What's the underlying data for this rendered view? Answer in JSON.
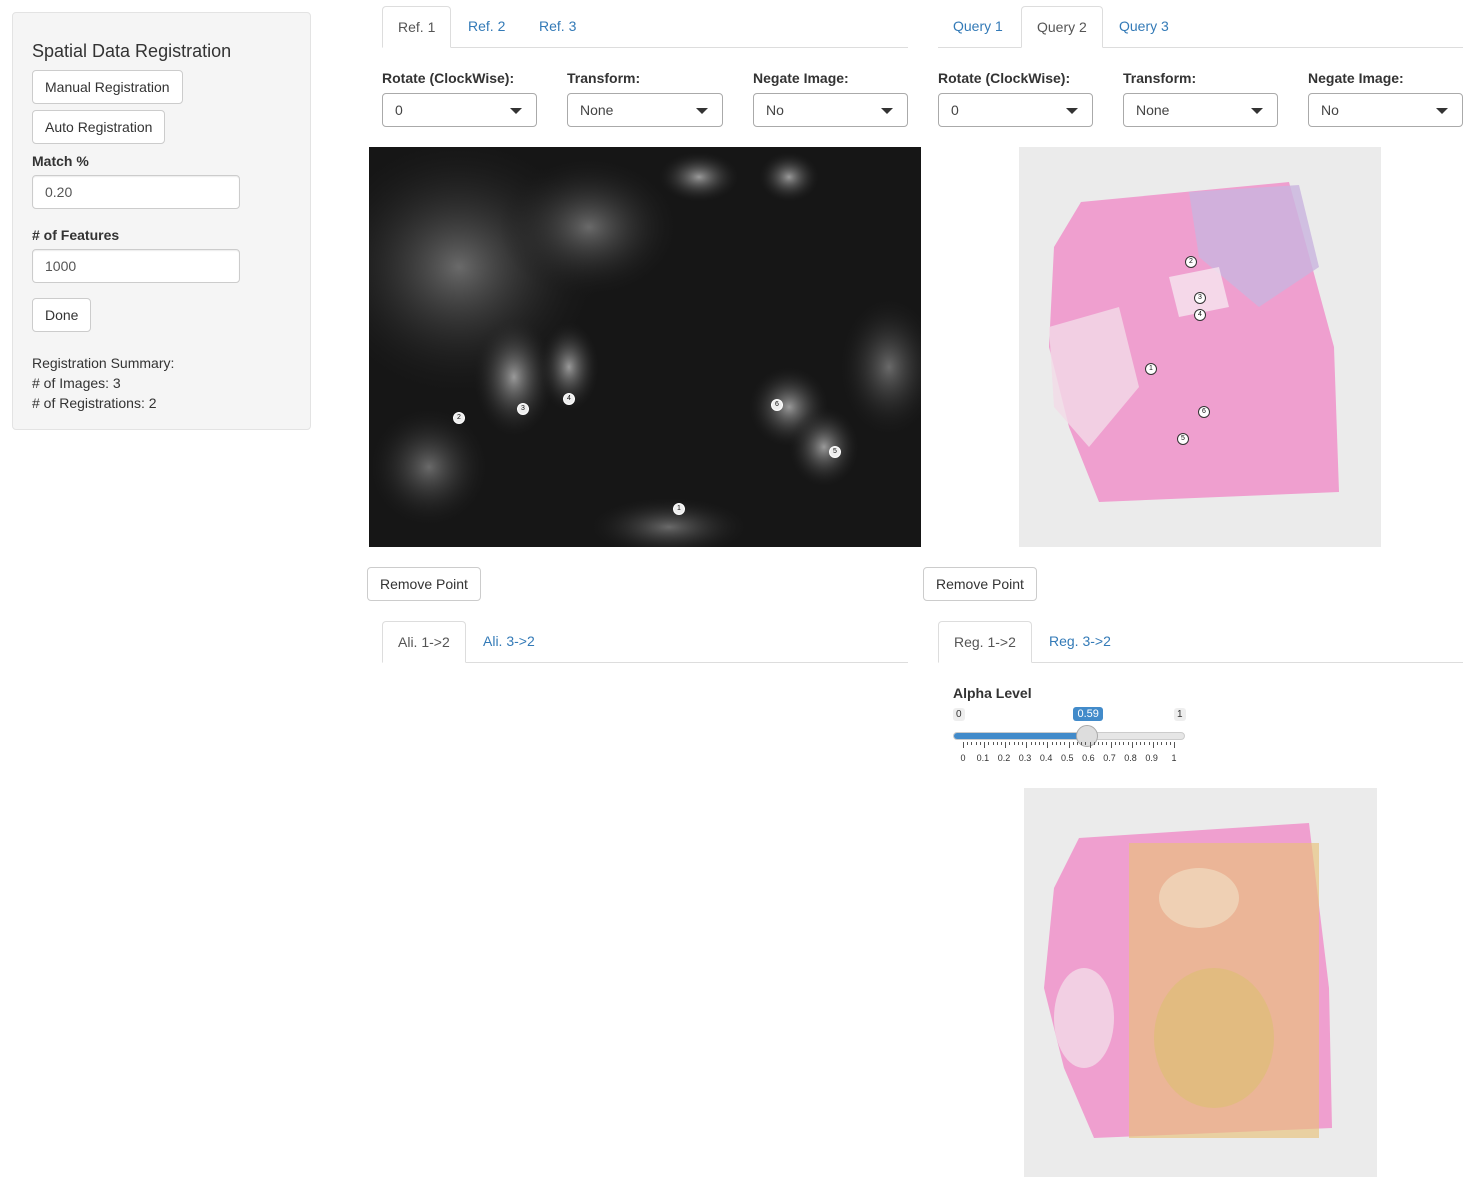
{
  "sidebar": {
    "title": "Spatial Data Registration",
    "manual_registration": "Manual Registration",
    "auto_registration": "Auto Registration",
    "match_label": "Match %",
    "match_value": "0.20",
    "features_label": "# of Features",
    "features_value": "1000",
    "done": "Done",
    "summary_title": "Registration Summary:",
    "summary_images": "# of Images: 3",
    "summary_registrations": "# of Registrations: 2"
  },
  "ref_panel": {
    "tabs": [
      "Ref. 1",
      "Ref. 2",
      "Ref. 3"
    ],
    "active_tab": 0,
    "rotate_label": "Rotate (ClockWise):",
    "rotate_value": "0",
    "transform_label": "Transform:",
    "transform_value": "None",
    "negate_label": "Negate Image:",
    "negate_value": "No",
    "remove_point": "Remove Point",
    "points": [
      "1",
      "2",
      "3",
      "4",
      "5",
      "6"
    ]
  },
  "query_panel": {
    "tabs": [
      "Query 1",
      "Query 2",
      "Query 3"
    ],
    "active_tab": 1,
    "rotate_label": "Rotate (ClockWise):",
    "rotate_value": "0",
    "transform_label": "Transform:",
    "transform_value": "None",
    "negate_label": "Negate Image:",
    "negate_value": "No",
    "remove_point": "Remove Point",
    "points": [
      "1",
      "2",
      "3",
      "4",
      "5",
      "6"
    ]
  },
  "alignment_tabs": [
    "Ali. 1->2",
    "Ali. 3->2"
  ],
  "registration_tabs": [
    "Reg. 1->2",
    "Reg. 3->2"
  ],
  "alpha": {
    "label": "Alpha Level",
    "min": "0",
    "max": "1",
    "value": 0.59,
    "value_label": "0.59",
    "ticks": [
      "0",
      "0.1",
      "0.2",
      "0.3",
      "0.4",
      "0.5",
      "0.6",
      "0.7",
      "0.8",
      "0.9",
      "1"
    ]
  },
  "colors": {
    "link": "#337ab7",
    "slider": "#428bca",
    "he_pink": "#f0a6cf",
    "overlay": "#e8c27a"
  }
}
